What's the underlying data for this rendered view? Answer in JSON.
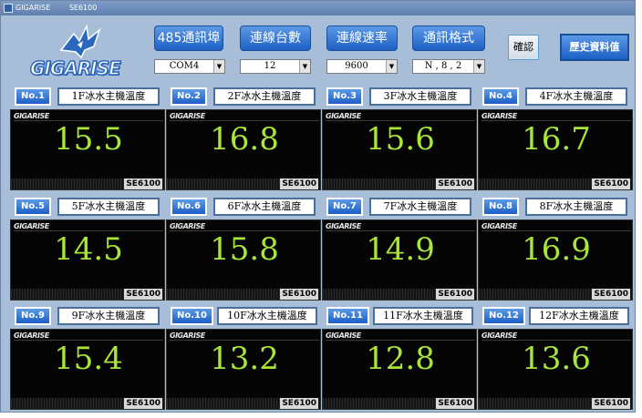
{
  "window": {
    "title_app": "GIGARISE",
    "title_model": "SE6100"
  },
  "logo": {
    "text": "GIGARISE"
  },
  "controls": [
    {
      "label": "485通訊埠",
      "value": "COM4"
    },
    {
      "label": "連線台數",
      "value": "12"
    },
    {
      "label": "連線速率",
      "value": "9600"
    },
    {
      "label": "通訊格式",
      "value": "N , 8 , 2"
    }
  ],
  "confirm_label": "確認",
  "history_label": "歷史資料值",
  "display_brand": "GIGARISE",
  "model_label": "SE6100",
  "channels": [
    {
      "no": "No.1",
      "name": "1F冰水主機溫度",
      "value": "15.5"
    },
    {
      "no": "No.2",
      "name": "2F冰水主機溫度",
      "value": "16.8"
    },
    {
      "no": "No.3",
      "name": "3F冰水主機溫度",
      "value": "15.6"
    },
    {
      "no": "No.4",
      "name": "4F冰水主機溫度",
      "value": "16.7"
    },
    {
      "no": "No.5",
      "name": "5F冰水主機溫度",
      "value": "14.5"
    },
    {
      "no": "No.6",
      "name": "6F冰水主機溫度",
      "value": "15.8"
    },
    {
      "no": "No.7",
      "name": "7F冰水主機溫度",
      "value": "14.9"
    },
    {
      "no": "No.8",
      "name": "8F冰水主機溫度",
      "value": "16.9"
    },
    {
      "no": "No.9",
      "name": "9F冰水主機溫度",
      "value": "15.4"
    },
    {
      "no": "No.10",
      "name": "10F冰水主機溫度",
      "value": "13.2"
    },
    {
      "no": "No.11",
      "name": "11F冰水主機溫度",
      "value": "12.8"
    },
    {
      "no": "No.12",
      "name": "12F冰水主機溫度",
      "value": "13.6"
    }
  ],
  "colors": {
    "background": "#a8bed8",
    "button_blue": "#1d5fc5",
    "display_value": "#a8e63a",
    "display_bg": "#050505"
  }
}
